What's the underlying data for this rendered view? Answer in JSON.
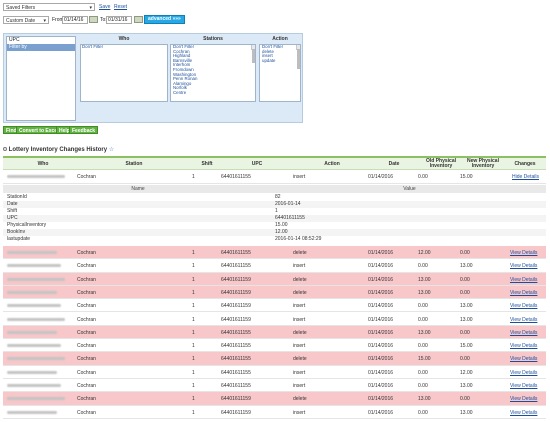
{
  "filters": {
    "saved_filters_label": "Saved Filters",
    "save_link": "Save",
    "reset_link": "Reset",
    "date_range_value": "Custom Date",
    "from_label": "From:",
    "from_value": "01/14/16",
    "to_label": "To:",
    "to_value": "01/31/16",
    "advanced_button": "advanced »»»"
  },
  "filter_panel": {
    "left_items": [
      "UPC",
      "Filter by"
    ],
    "selected_left_item": 1,
    "who_header": "Who",
    "who_items": [
      "Don't Filter"
    ],
    "stations_header": "Stations",
    "stations_items": [
      "Don't Filter",
      "Cochran",
      "Highland",
      "Barnsville",
      "Interhom",
      "Fromdown",
      "Washington",
      "Penn Ronan",
      "Alamingo",
      "Norfolk",
      "Centre"
    ],
    "action_header": "Action",
    "action_items": [
      "Don't Filter",
      "delete",
      "insert",
      "update"
    ]
  },
  "buttons": {
    "find": "Find",
    "convert": "Convert to Excel",
    "help": "Help",
    "feedback": "Feedback"
  },
  "history": {
    "title": "Lottery Inventory Changes History",
    "star_icon": "star-icon"
  },
  "table": {
    "headers": {
      "who": "Who",
      "station": "Station",
      "shift": "Shift",
      "upc": "UPC",
      "action": "Action",
      "date": "Date",
      "old_inv": "Old Physical Inventory",
      "new_inv": "New Physical Inventory",
      "changes": "Changes"
    },
    "expanded_row": {
      "station": "Cochran",
      "shift": "1",
      "upc": "64401611155",
      "action": "insert",
      "date": "01/14/2016",
      "old": "0.00",
      "new": "15.00",
      "link": "Hide Details"
    },
    "details": {
      "name_header": "Name",
      "value_header": "Value",
      "rows": [
        {
          "name": "StationId",
          "value": "82"
        },
        {
          "name": "Date",
          "value": "2016-01-14"
        },
        {
          "name": "Shift",
          "value": "1"
        },
        {
          "name": "UPC",
          "value": "64401611155"
        },
        {
          "name": "PhysicalInventory",
          "value": "15.00"
        },
        {
          "name": "BookInv",
          "value": "12.00"
        },
        {
          "name": "lastupdate",
          "value": "2016-01-14 08:52:29"
        }
      ]
    },
    "rows": [
      {
        "color": "red",
        "station": "Cochran",
        "shift": "1",
        "upc": "64401611155",
        "action": "delete",
        "date": "01/14/2016",
        "old": "12.00",
        "new": "0.00",
        "link": "View Details"
      },
      {
        "color": "white",
        "station": "Cochran",
        "shift": "1",
        "upc": "64401611155",
        "action": "insert",
        "date": "01/14/2016",
        "old": "0.00",
        "new": "13.00",
        "link": "View Details"
      },
      {
        "color": "red",
        "station": "Cochran",
        "shift": "1",
        "upc": "64401611159",
        "action": "delete",
        "date": "01/14/2016",
        "old": "13.00",
        "new": "0.00",
        "link": "View Details"
      },
      {
        "color": "red",
        "station": "Cochran",
        "shift": "1",
        "upc": "64401611159",
        "action": "delete",
        "date": "01/14/2016",
        "old": "13.00",
        "new": "0.00",
        "link": "View Details"
      },
      {
        "color": "white",
        "station": "Cochran",
        "shift": "1",
        "upc": "64401611159",
        "action": "insert",
        "date": "01/14/2016",
        "old": "0.00",
        "new": "13.00",
        "link": "View Details"
      },
      {
        "color": "white",
        "station": "Cochran",
        "shift": "1",
        "upc": "64401611159",
        "action": "insert",
        "date": "01/14/2016",
        "old": "0.00",
        "new": "13.00",
        "link": "View Details"
      },
      {
        "color": "red",
        "station": "Cochran",
        "shift": "1",
        "upc": "64401611155",
        "action": "delete",
        "date": "01/14/2016",
        "old": "13.00",
        "new": "0.00",
        "link": "View Details"
      },
      {
        "color": "white",
        "station": "Cochran",
        "shift": "1",
        "upc": "64401611155",
        "action": "insert",
        "date": "01/14/2016",
        "old": "0.00",
        "new": "15.00",
        "link": "View Details"
      },
      {
        "color": "red",
        "station": "Cochran",
        "shift": "1",
        "upc": "64401611155",
        "action": "delete",
        "date": "01/14/2016",
        "old": "15.00",
        "new": "0.00",
        "link": "View Details"
      },
      {
        "color": "white",
        "station": "Cochran",
        "shift": "1",
        "upc": "64401611155",
        "action": "insert",
        "date": "01/14/2016",
        "old": "0.00",
        "new": "12.00",
        "link": "View Details"
      },
      {
        "color": "white",
        "station": "Cochran",
        "shift": "1",
        "upc": "64401611155",
        "action": "insert",
        "date": "01/14/2016",
        "old": "0.00",
        "new": "13.00",
        "link": "View Details"
      },
      {
        "color": "red",
        "station": "Cochran",
        "shift": "1",
        "upc": "64401611159",
        "action": "delete",
        "date": "01/14/2016",
        "old": "13.00",
        "new": "0.00",
        "link": "View Details"
      },
      {
        "color": "white",
        "station": "Cochran",
        "shift": "1",
        "upc": "64401611159",
        "action": "insert",
        "date": "01/14/2016",
        "old": "0.00",
        "new": "13.00",
        "link": "View Details"
      }
    ]
  }
}
